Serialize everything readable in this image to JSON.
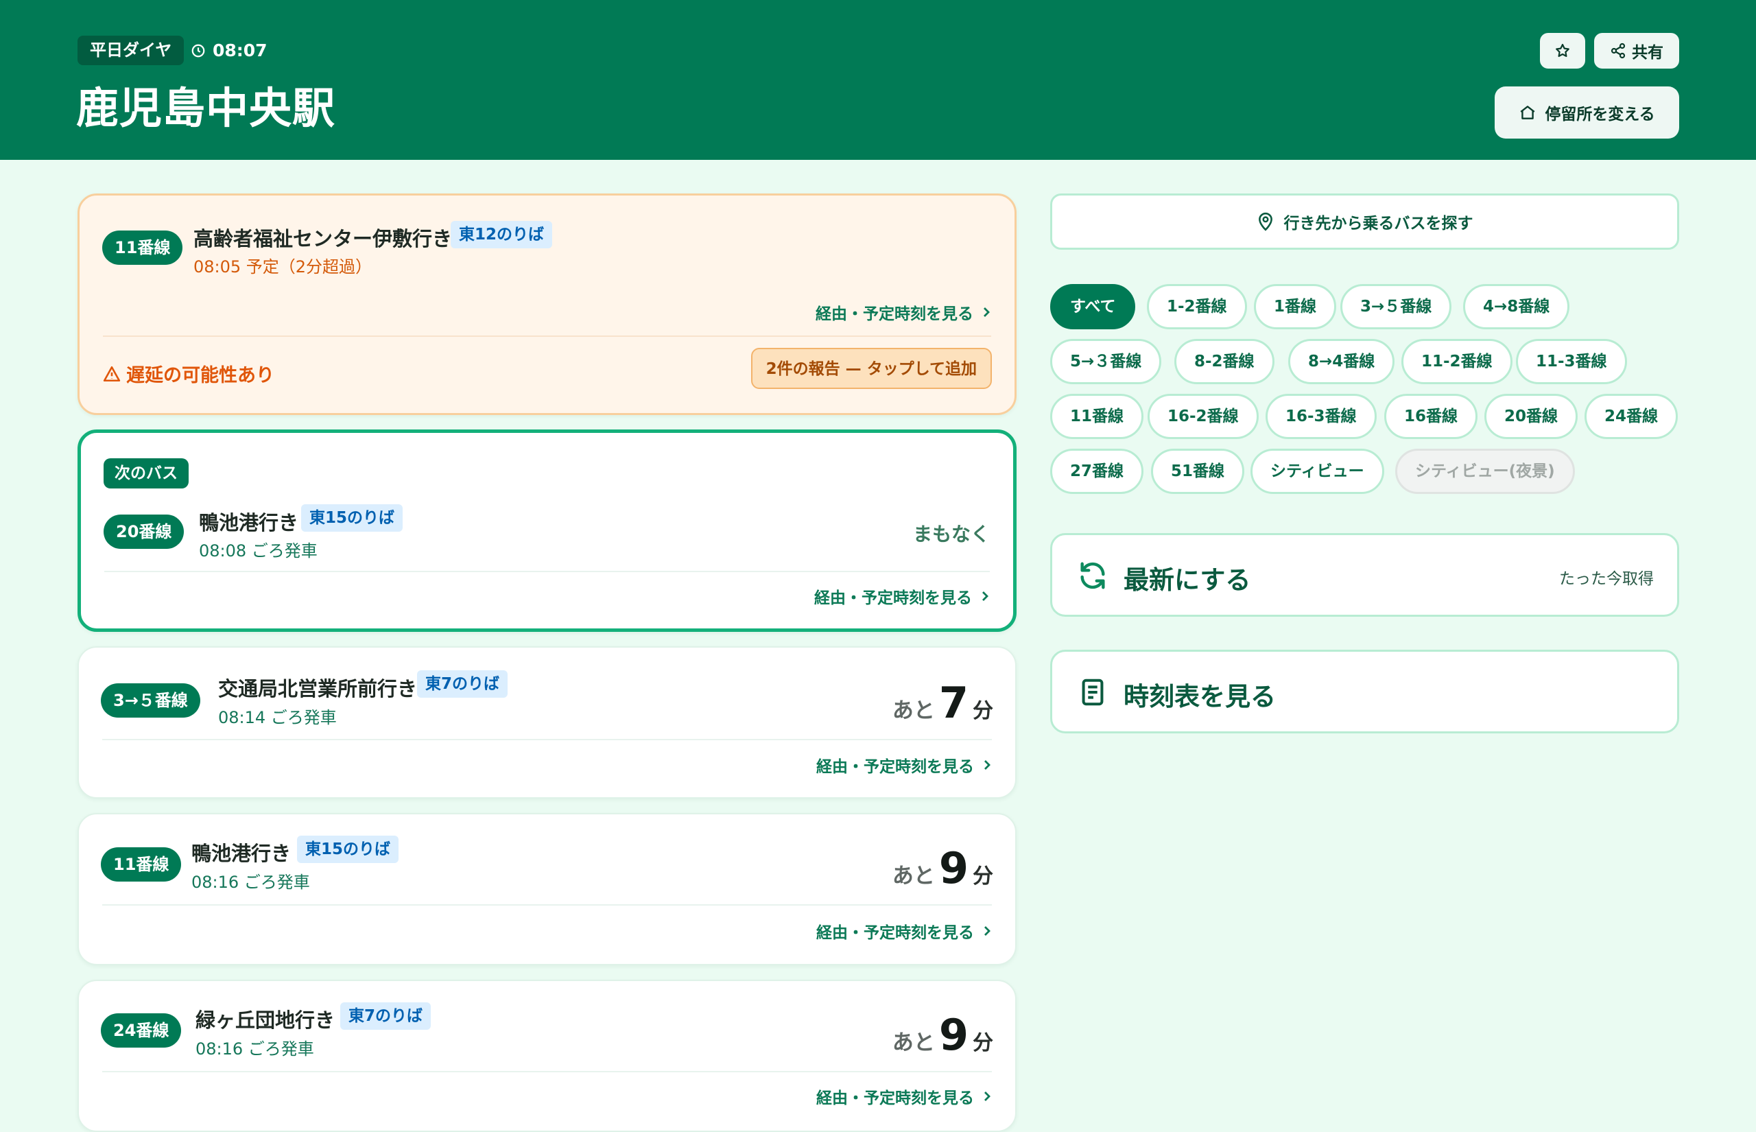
{
  "header": {
    "schedule_badge": "平日ダイヤ",
    "time": "08:07",
    "stop_name": "鹿児島中央駅",
    "favorite_icon": "star-icon",
    "share_label": "共有",
    "change_stop_label": "停留所を変える"
  },
  "departures": [
    {
      "route": "11番線",
      "destination": "高齢者福祉センター伊敷行き",
      "platform": "東12のりば",
      "time_text": "08:05 予定（2分超過）",
      "link": "経由・予定時刻を見る",
      "warning": "遅延の可能性あり",
      "report_button": "2件の報告 — タップして追加",
      "status": "delayed"
    },
    {
      "badge": "次のバス",
      "route": "20番線",
      "destination": "鴨池港行き",
      "platform": "東15のりば",
      "time_text": "08:08 ごろ発車",
      "eta_text": "まもなく",
      "link": "経由・予定時刻を見る",
      "status": "next"
    },
    {
      "route": "3→５番線",
      "destination": "交通局北営業所前行き",
      "platform": "東7のりば",
      "time_text": "08:14 ごろ発車",
      "eta_prefix": "あと",
      "eta_minutes": "7",
      "eta_unit": "分",
      "link": "経由・予定時刻を見る"
    },
    {
      "route": "11番線",
      "destination": "鴨池港行き",
      "platform": "東15のりば",
      "time_text": "08:16 ごろ発車",
      "eta_prefix": "あと",
      "eta_minutes": "9",
      "eta_unit": "分",
      "link": "経由・予定時刻を見る"
    },
    {
      "route": "24番線",
      "destination": "緑ヶ丘団地行き",
      "platform": "東7のりば",
      "time_text": "08:16 ごろ発車",
      "eta_prefix": "あと",
      "eta_minutes": "9",
      "eta_unit": "分",
      "link": "経由・予定時刻を見る"
    }
  ],
  "sidebar": {
    "search_by_destination": "行き先から乗るバスを探す",
    "route_filters": [
      {
        "label": "すべて",
        "state": "active"
      },
      {
        "label": "1-2番線",
        "state": "normal"
      },
      {
        "label": "1番線",
        "state": "normal"
      },
      {
        "label": "3→５番線",
        "state": "normal"
      },
      {
        "label": "4→8番線",
        "state": "normal"
      },
      {
        "label": "5→３番線",
        "state": "normal"
      },
      {
        "label": "8-2番線",
        "state": "normal"
      },
      {
        "label": "8→4番線",
        "state": "normal"
      },
      {
        "label": "11-2番線",
        "state": "normal"
      },
      {
        "label": "11-3番線",
        "state": "normal"
      },
      {
        "label": "11番線",
        "state": "normal"
      },
      {
        "label": "16-2番線",
        "state": "normal"
      },
      {
        "label": "16-3番線",
        "state": "normal"
      },
      {
        "label": "16番線",
        "state": "normal"
      },
      {
        "label": "20番線",
        "state": "normal"
      },
      {
        "label": "24番線",
        "state": "normal"
      },
      {
        "label": "27番線",
        "state": "normal"
      },
      {
        "label": "51番線",
        "state": "normal"
      },
      {
        "label": "シティビュー",
        "state": "normal"
      },
      {
        "label": "シティビュー(夜景)",
        "state": "disabled"
      }
    ],
    "refresh_label": "最新にする",
    "refresh_meta": "たった今取得",
    "timetable_label": "時刻表を見る"
  },
  "colors": {
    "brand": "#017a55",
    "background": "#eafbf2",
    "warning": "#e0560a",
    "platform_blue": "#0060b0"
  }
}
